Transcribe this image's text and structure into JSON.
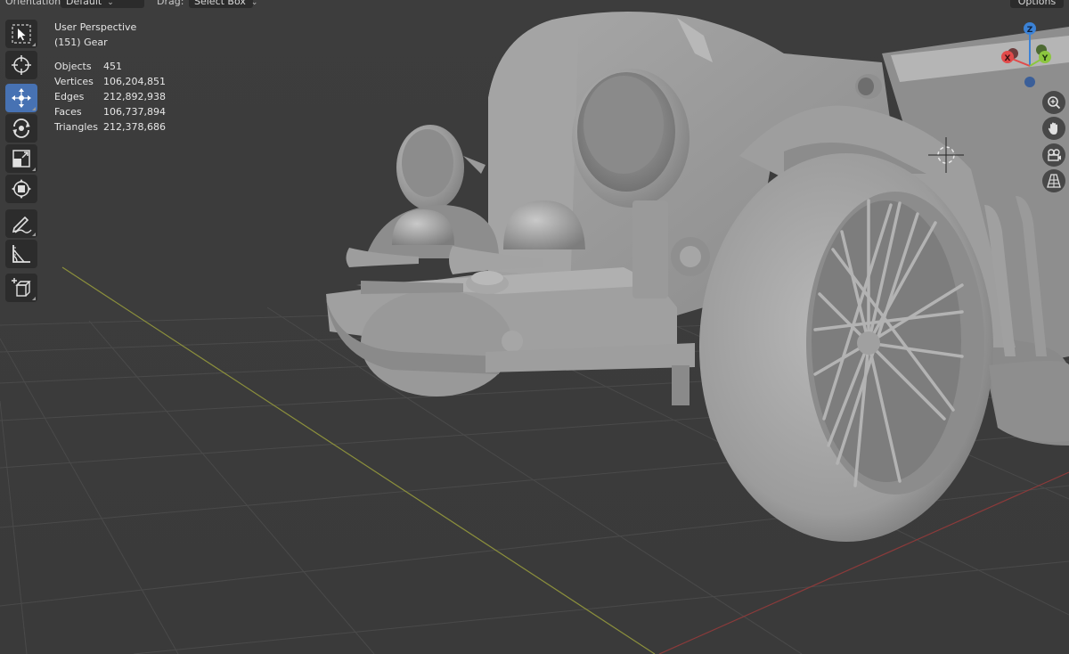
{
  "header": {
    "orientation_label": "Orientation:",
    "orientation_value": "Default",
    "drag_label": "Drag:",
    "drag_value": "Select Box",
    "options_label": "Options"
  },
  "toolbar": {
    "active_tool": "move",
    "tools": [
      "select-box",
      "cursor",
      "move",
      "rotate",
      "scale",
      "transform",
      "annotate",
      "measure",
      "add-cube"
    ]
  },
  "overlay": {
    "view_name": "User Perspective",
    "collection_info": "(151) Gear",
    "stats": [
      {
        "label": "Objects",
        "value": "451"
      },
      {
        "label": "Vertices",
        "value": "106,204,851"
      },
      {
        "label": "Edges",
        "value": "212,892,938"
      },
      {
        "label": "Faces",
        "value": "106,737,894"
      },
      {
        "label": "Triangles",
        "value": "212,378,686"
      }
    ]
  },
  "gizmo": {
    "z_label": "Z",
    "x_label": "X",
    "y_label": "Y",
    "colors": {
      "x": "#e14a4a",
      "y": "#8cc63f",
      "z": "#3b82d6"
    }
  },
  "nav_buttons": [
    "zoom-icon",
    "pan-hand-icon",
    "camera-icon",
    "perspective-grid-icon"
  ],
  "colors": {
    "background": "#3d3d3d",
    "active_tool": "#4772b3",
    "toolbar_button": "#2c2c2c",
    "model": "#9a9a9a"
  }
}
